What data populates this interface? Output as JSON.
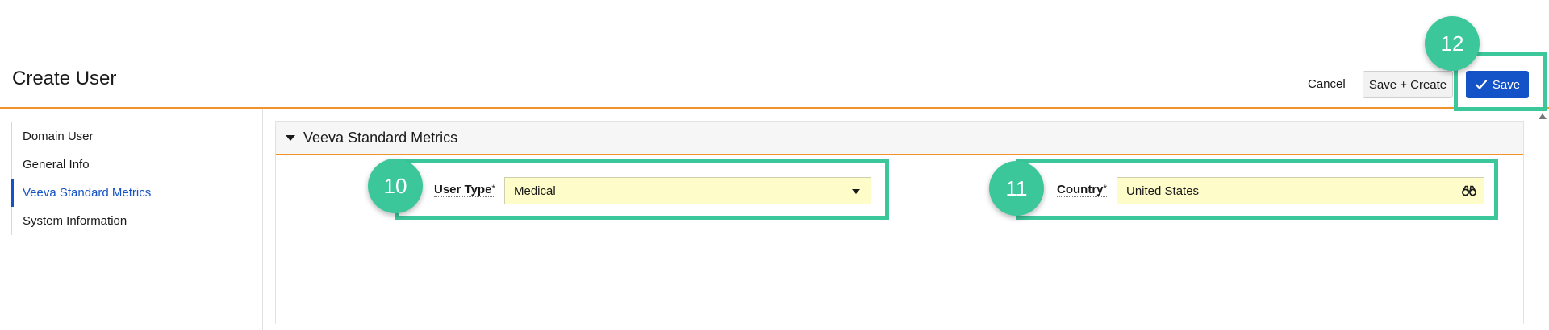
{
  "header": {
    "title": "Create User",
    "cancel_label": "Cancel",
    "save_create_label": "Save + Create",
    "save_label": "Save"
  },
  "sidebar": {
    "items": [
      {
        "label": "Domain User"
      },
      {
        "label": "General Info"
      },
      {
        "label": "Veeva Standard Metrics",
        "active": true
      },
      {
        "label": "System Information"
      }
    ]
  },
  "section": {
    "title": "Veeva Standard Metrics",
    "fields": {
      "user_type": {
        "label": "User Type",
        "required": "*",
        "value": "Medical"
      },
      "country": {
        "label": "Country",
        "required": "*",
        "value": "United States"
      }
    }
  },
  "annotations": [
    {
      "number": "10"
    },
    {
      "number": "11"
    },
    {
      "number": "12"
    }
  ],
  "colors": {
    "accent_orange": "#f0932b",
    "primary_blue": "#1453c7",
    "annotation_green": "#3cc79b",
    "field_fill": "#fefcc8"
  }
}
